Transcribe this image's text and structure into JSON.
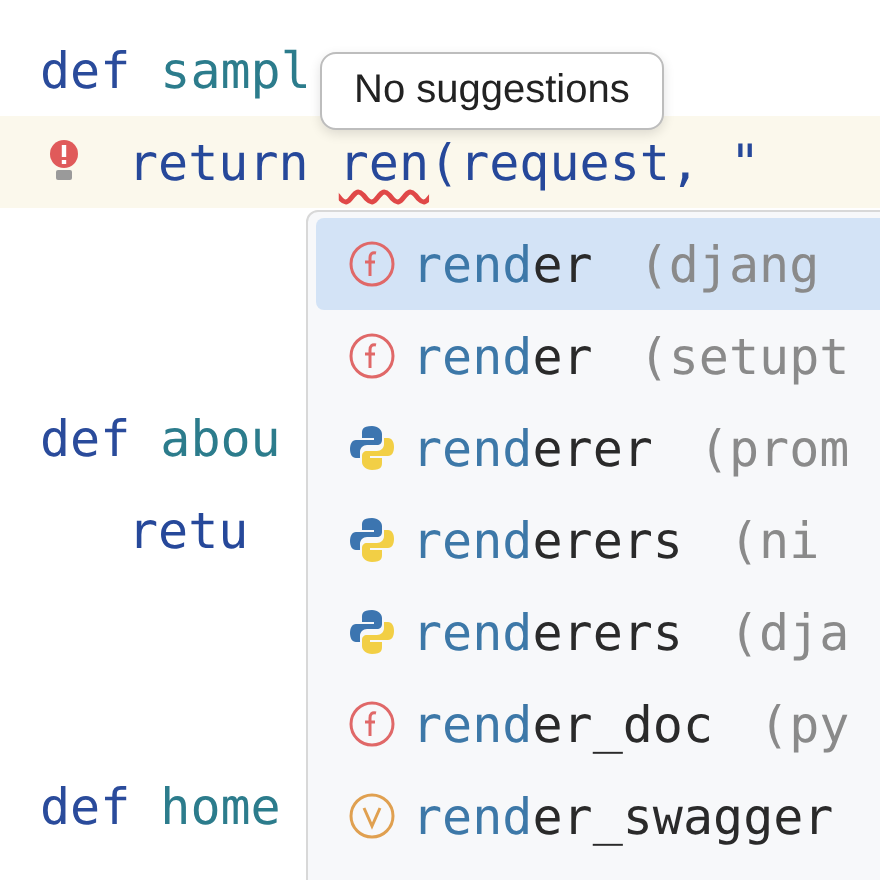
{
  "editor": {
    "lines": [
      {
        "kind": "def",
        "keyword": "def",
        "name": "sampl"
      },
      {
        "kind": "return",
        "current": true,
        "warning": true,
        "keyword": "return",
        "error": "ren",
        "rest": "(request, \""
      },
      {
        "kind": "blank"
      },
      {
        "kind": "blank"
      },
      {
        "kind": "def",
        "keyword": "def",
        "name": "abou"
      },
      {
        "kind": "return",
        "current": false,
        "keyword": "retu"
      },
      {
        "kind": "blank"
      },
      {
        "kind": "blank"
      },
      {
        "kind": "def",
        "keyword": "def",
        "name": "home"
      }
    ]
  },
  "tooltip": {
    "text": "No suggestions"
  },
  "completion": {
    "items": [
      {
        "kind": "function",
        "match": "rend",
        "rest": "er",
        "detail": "(djang",
        "selected": true
      },
      {
        "kind": "function",
        "match": "rend",
        "rest": "er",
        "detail": "(setupt",
        "selected": false
      },
      {
        "kind": "module",
        "match": "rend",
        "rest": "erer",
        "detail": "(prom",
        "selected": false
      },
      {
        "kind": "module",
        "match": "rend",
        "rest": "erers",
        "detail": "(ni",
        "selected": false
      },
      {
        "kind": "module",
        "match": "rend",
        "rest": "erers",
        "detail": "(dja",
        "selected": false
      },
      {
        "kind": "function",
        "match": "rend",
        "rest": "er_doc",
        "detail": "(py",
        "selected": false
      },
      {
        "kind": "variable",
        "match": "rend",
        "rest": "er_swagger",
        "selected": false
      }
    ]
  }
}
